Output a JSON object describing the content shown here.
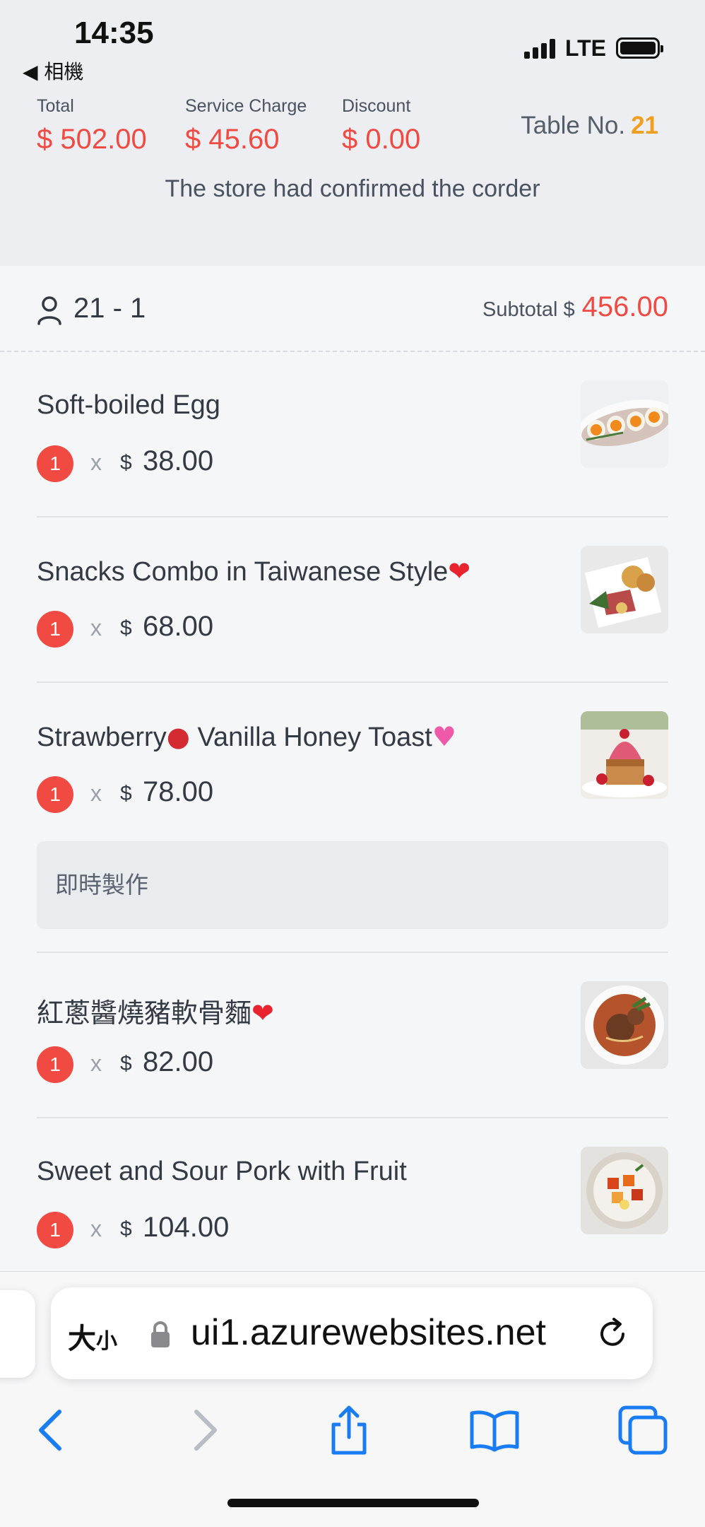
{
  "status_bar": {
    "time": "14:35",
    "back_app": "◀ 相機",
    "network": "LTE"
  },
  "summary": {
    "total_label": "Total",
    "total_value": "$ 502.00",
    "service_label": "Service Charge",
    "service_value": "$ 45.60",
    "discount_label": "Discount",
    "discount_value": "$ 0.00",
    "table_label": "Table No.",
    "table_number": "21",
    "confirm_message": "The store had confirmed the corder"
  },
  "group": {
    "label": "21 - 1",
    "subtotal_label": "Subtotal $",
    "subtotal_value": "456.00"
  },
  "items": [
    {
      "name": "Soft-boiled Egg",
      "emoji": "",
      "qty": "1",
      "times": "x",
      "currency": "$",
      "price": "38.00",
      "note": ""
    },
    {
      "name": "Snacks Combo in Taiwanese Style",
      "emoji": "❤",
      "qty": "1",
      "times": "x",
      "currency": "$",
      "price": "68.00",
      "note": ""
    },
    {
      "name_a": "Strawberry",
      "emoji_a": "●",
      "name_b": " Vanilla Honey Toast",
      "emoji_b": "♥",
      "qty": "1",
      "times": "x",
      "currency": "$",
      "price": "78.00",
      "note": "即時製作"
    },
    {
      "name": "紅蔥醬燒豬軟骨麵",
      "emoji": "❤",
      "qty": "1",
      "times": "x",
      "currency": "$",
      "price": "82.00",
      "note": ""
    },
    {
      "name": "Sweet and Sour Pork with Fruit",
      "emoji": "",
      "qty": "1",
      "times": "x",
      "currency": "$",
      "price": "104.00",
      "note": ""
    }
  ],
  "browser": {
    "text_size_label": "大",
    "text_size_small": "小",
    "url": "ui1.azurewebsites.net"
  },
  "colors": {
    "accent_red": "#f04a42",
    "table_orange": "#f0a020",
    "safari_blue": "#1a7cf2"
  }
}
